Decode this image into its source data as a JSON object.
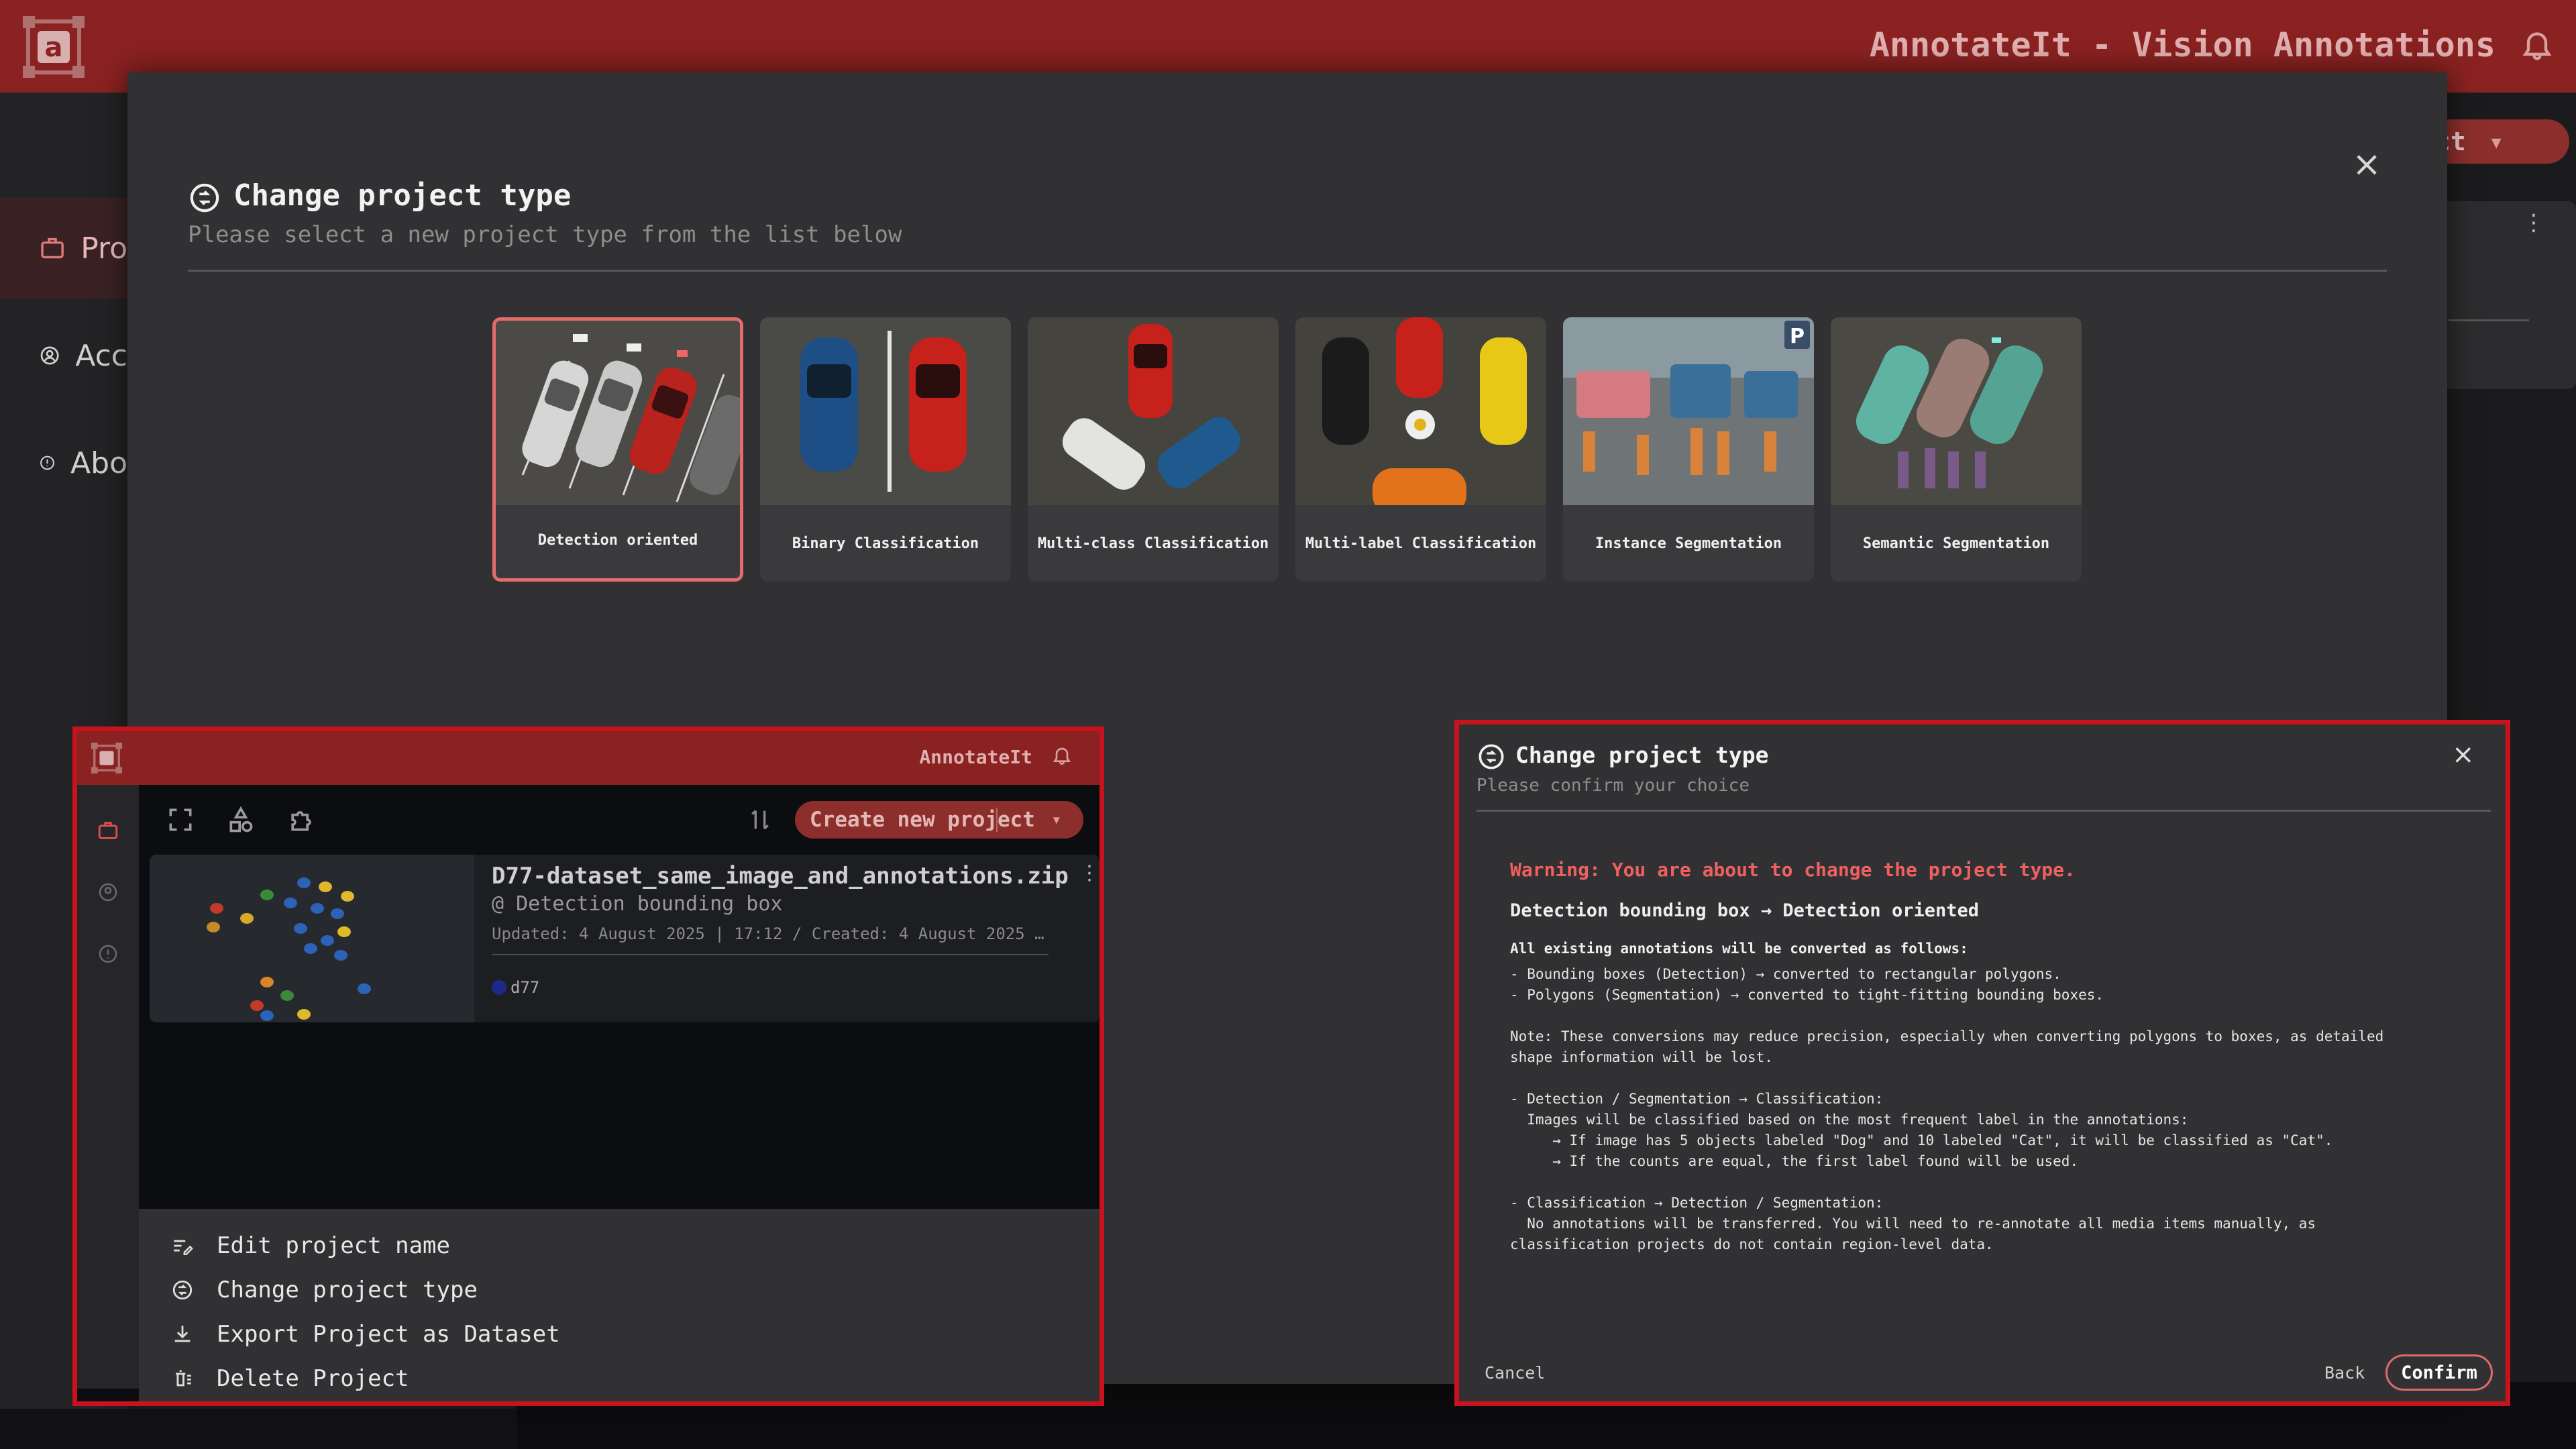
{
  "app": {
    "title": "AnnotateIt - Vision Annotations",
    "nav_projects": "Pro",
    "nav_account": "Acc",
    "nav_about": "Abo",
    "create_button_fragment": "ct"
  },
  "modal": {
    "title": "Change project type",
    "subtitle": "Please select a new project type from the list below",
    "close": "×",
    "project_types": [
      {
        "label": "Detection oriented",
        "selected": true
      },
      {
        "label": "Binary Classification",
        "selected": false
      },
      {
        "label": "Multi-class Classification",
        "selected": false
      },
      {
        "label": "Multi-label Classification",
        "selected": false
      },
      {
        "label": "Instance Segmentation",
        "selected": false
      },
      {
        "label": "Semantic Segmentation",
        "selected": false
      }
    ]
  },
  "inset1": {
    "app_title": "AnnotateIt",
    "create_button": "Create new project",
    "project": {
      "file_name": "D77-dataset_same_image_and_annotations.zip",
      "type": "@ Detection bounding box",
      "dates": "Updated: 4 August 2025 | 17:12 / Created: 4 August 2025 …",
      "tag": "d77"
    },
    "menu": [
      {
        "label": "Edit project name",
        "icon": "edit-icon"
      },
      {
        "label": "Change project type",
        "icon": "swap-icon"
      },
      {
        "label": "Export Project as Dataset",
        "icon": "download-icon"
      },
      {
        "label": "Delete Project",
        "icon": "delete-icon"
      }
    ]
  },
  "inset2": {
    "title": "Change project type",
    "subtitle": "Please confirm your choice",
    "close": "×",
    "warning": "Warning: You are about to change the project type.",
    "change_summary": "Detection bounding box → Detection oriented",
    "convert_head": "All existing annotations will be converted as follows:",
    "lines": [
      "- Bounding boxes (Detection) → converted to rectangular polygons.",
      "- Polygons (Segmentation) → converted to tight-fitting bounding boxes.",
      "",
      "Note: These conversions may reduce precision, especially when converting polygons to boxes, as detailed",
      "shape information will be lost.",
      "",
      "- Detection / Segmentation → Classification:",
      "  Images will be classified based on the most frequent label in the annotations:",
      "     → If image has 5 objects labeled \"Dog\" and 10 labeled \"Cat\", it will be classified as \"Cat\".",
      "     → If the counts are equal, the first label found will be used.",
      "",
      "- Classification → Detection / Segmentation:",
      "  No annotations will be transferred. You will need to re-annotate all media items manually, as",
      "classification projects do not contain region-level data."
    ],
    "cancel": "Cancel",
    "back": "Back",
    "confirm": "Confirm"
  },
  "colors": {
    "header_red": "#8a2221",
    "accent_red": "#e46c6c",
    "warning_red": "#f06060",
    "inset_border": "#c8121e"
  }
}
